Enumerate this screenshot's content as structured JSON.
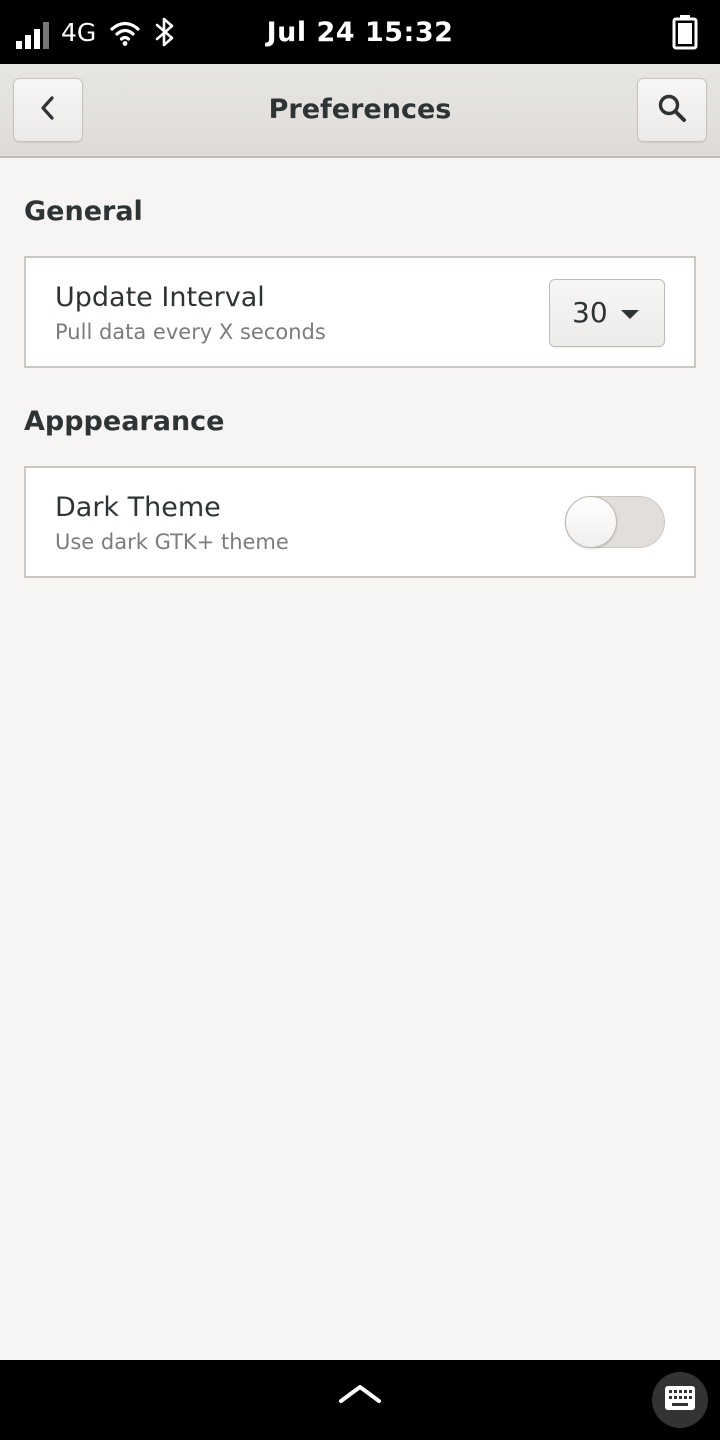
{
  "status_bar": {
    "network_type": "4G",
    "clock": "Jul 24  15:32",
    "signal_bars_full": 3,
    "signal_bars_total": 4
  },
  "header": {
    "title": "Preferences",
    "back_icon": "chevron-left-icon",
    "search_icon": "search-icon"
  },
  "sections": [
    {
      "title": "General",
      "rows": [
        {
          "title": "Update Interval",
          "subtitle": "Pull data every X seconds",
          "control": "combo",
          "value": "30"
        }
      ]
    },
    {
      "title": "Apppearance",
      "rows": [
        {
          "title": "Dark Theme",
          "subtitle": "Use dark GTK+ theme",
          "control": "switch",
          "value": false
        }
      ]
    }
  ],
  "bottom_bar": {
    "home_icon": "chevron-up-icon",
    "keyboard_icon": "keyboard-icon"
  },
  "colors": {
    "background": "#f6f5f4",
    "header": "#e8e6e3",
    "text": "#2e3436",
    "subtitle": "#7a7d7c"
  }
}
